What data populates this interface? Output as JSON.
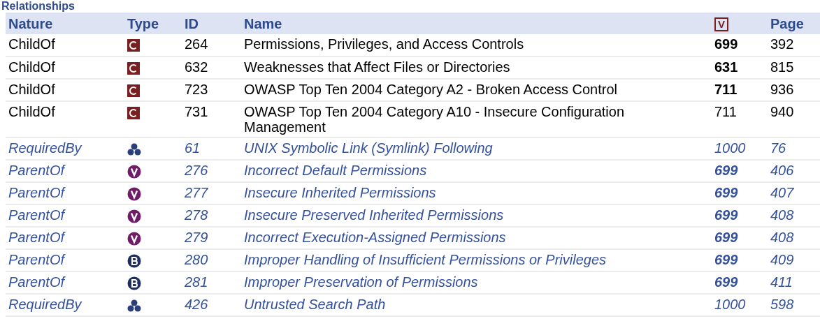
{
  "heading": "Relationships",
  "columns": [
    {
      "kind": "text",
      "label": "Nature"
    },
    {
      "kind": "text",
      "label": "Type"
    },
    {
      "kind": "text",
      "label": "ID"
    },
    {
      "kind": "text",
      "label": "Name"
    },
    {
      "kind": "view-icon",
      "label": "V"
    },
    {
      "kind": "text",
      "label": "Page"
    }
  ],
  "rows": [
    {
      "nature": "ChildOf",
      "kind": "category",
      "id": "264",
      "name": "Permissions, Privileges, and Access Controls",
      "view": "699",
      "view_bold": true,
      "page": "392",
      "italic": false
    },
    {
      "nature": "ChildOf",
      "kind": "category",
      "id": "632",
      "name": "Weaknesses that Affect Files or Directories",
      "view": "631",
      "view_bold": true,
      "page": "815",
      "italic": false
    },
    {
      "nature": "ChildOf",
      "kind": "category",
      "id": "723",
      "name": "OWASP Top Ten 2004 Category A2 - Broken Access Control",
      "view": "711",
      "view_bold": true,
      "page": "936",
      "italic": false
    },
    {
      "nature": "ChildOf",
      "kind": "category",
      "id": "731",
      "name": "OWASP Top Ten 2004 Category A10 - Insecure Configuration Management",
      "view": "711",
      "view_bold": false,
      "page": "940",
      "italic": false
    },
    {
      "nature": "RequiredBy",
      "kind": "chain",
      "id": "61",
      "name": "UNIX Symbolic Link (Symlink) Following",
      "view": "1000",
      "view_bold": false,
      "page": "76",
      "italic": true
    },
    {
      "nature": "ParentOf",
      "kind": "variant",
      "id": "276",
      "name": "Incorrect Default Permissions",
      "view": "699",
      "view_bold": true,
      "page": "406",
      "italic": true
    },
    {
      "nature": "ParentOf",
      "kind": "variant",
      "id": "277",
      "name": "Insecure Inherited Permissions",
      "view": "699",
      "view_bold": true,
      "page": "407",
      "italic": true
    },
    {
      "nature": "ParentOf",
      "kind": "variant",
      "id": "278",
      "name": "Insecure Preserved Inherited Permissions",
      "view": "699",
      "view_bold": true,
      "page": "408",
      "italic": true
    },
    {
      "nature": "ParentOf",
      "kind": "variant",
      "id": "279",
      "name": "Incorrect Execution-Assigned Permissions",
      "view": "699",
      "view_bold": true,
      "page": "408",
      "italic": true
    },
    {
      "nature": "ParentOf",
      "kind": "base",
      "id": "280",
      "name": "Improper Handling of Insufficient Permissions or Privileges",
      "view": "699",
      "view_bold": true,
      "page": "409",
      "italic": true
    },
    {
      "nature": "ParentOf",
      "kind": "base",
      "id": "281",
      "name": "Improper Preservation of Permissions",
      "view": "699",
      "view_bold": true,
      "page": "411",
      "italic": true
    },
    {
      "nature": "RequiredBy",
      "kind": "chain",
      "id": "426",
      "name": "Untrusted Search Path",
      "view": "1000",
      "view_bold": false,
      "page": "598",
      "italic": true
    }
  ]
}
